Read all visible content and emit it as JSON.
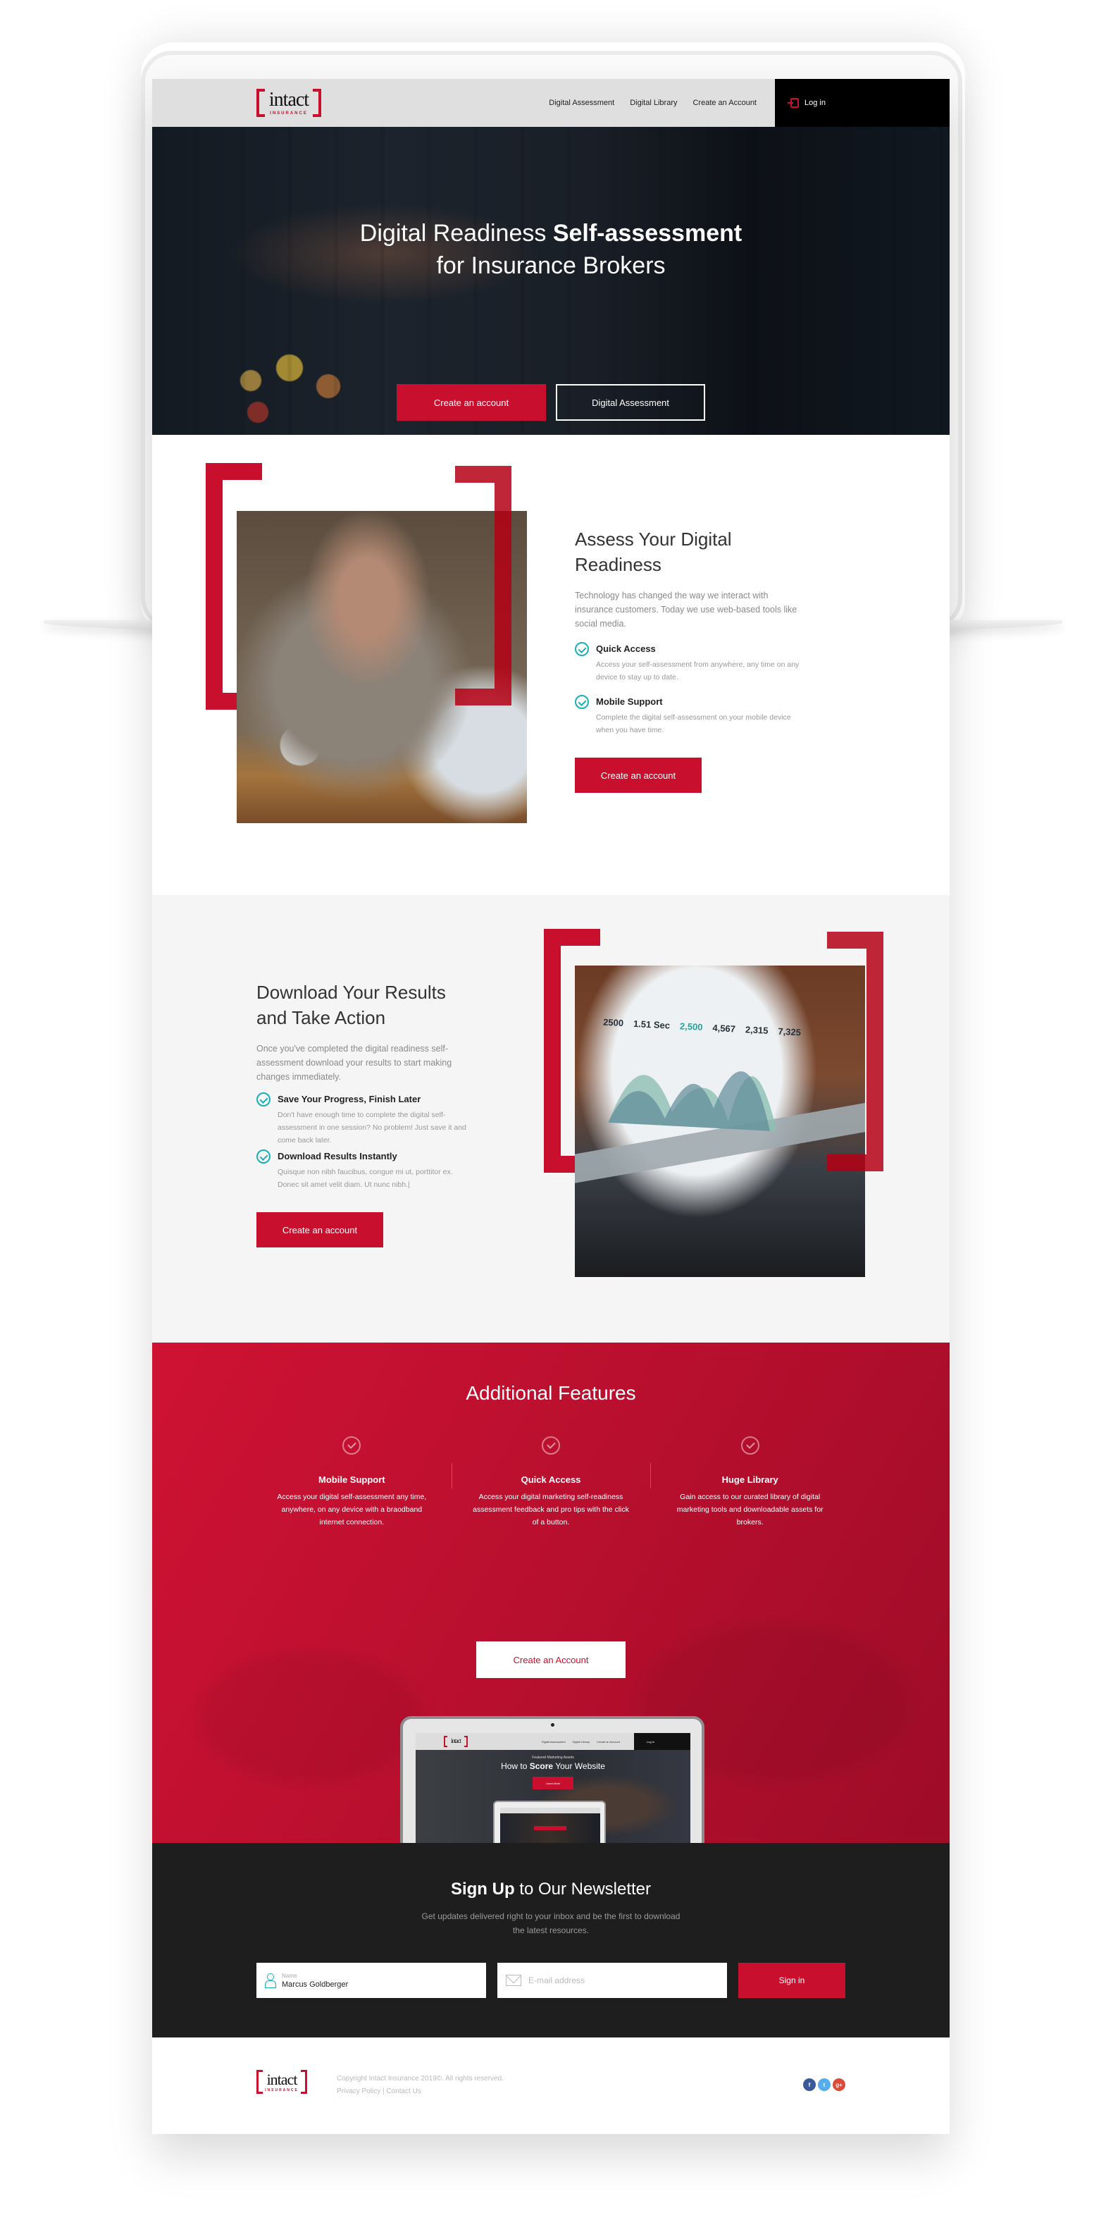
{
  "brand": {
    "logo_word": "intact",
    "logo_sub": "INSURANCE",
    "accent": "#c8102e",
    "check_color": "#1ab0b8"
  },
  "nav": {
    "links": [
      "Digital Assessment",
      "Digital Library",
      "Create an Account"
    ],
    "login_label": "Log in"
  },
  "hero": {
    "title_regular": "Digital Readiness ",
    "title_bold": "Self-assessment",
    "title_line2": "for Insurance Brokers",
    "primary_button": "Create an account",
    "secondary_button": "Digital Assessment"
  },
  "assess": {
    "title": "Assess Your Digital Readiness",
    "lead": "Technology has changed the way we interact with insurance customers. Today we use web-based tools like social media.",
    "features": [
      {
        "title": "Quick Access",
        "text": "Access your self-assessment from anywhere, any time on any device to stay up to date."
      },
      {
        "title": "Mobile Support",
        "text": "Complete the digital self-assessment on your mobile device when you have time."
      }
    ],
    "button": "Create an account"
  },
  "download": {
    "title": "Download Your Results and Take Action",
    "lead": "Once you've completed the digital readiness self-assessment download your results to start making changes immediately.",
    "features": [
      {
        "title": "Save Your Progress, Finish Later",
        "text": "Don't have enough time to complete the digital self-assessment in one session? No problem! Just save it and come back later."
      },
      {
        "title": "Download Results Instantly",
        "text": "Quisque non nibh faucibus, congue mi ut, porttitor ex. Donec sit amet velit diam. Ut nunc nibh.|"
      }
    ],
    "button": "Create an account",
    "dashboard_values": [
      "2500",
      "1.51 Sec",
      "2,500",
      "4,567",
      "2,315",
      "7,325"
    ]
  },
  "features": {
    "title": "Additional Features",
    "items": [
      {
        "title": "Mobile Support",
        "text": "Access your digital self-assessment any time, anywhere, on any device with a braodband internet connection."
      },
      {
        "title": "Quick Access",
        "text": "Access your digital marketing self-readiness assessment feedback and pro tips with the click of a button."
      },
      {
        "title": "Huge Library",
        "text": "Gain access to our curated library of digital marketing tools and downloadable assets for brokers."
      }
    ],
    "button": "Create an Account",
    "preview": {
      "nav_links": [
        "Digital Assessment",
        "Digital Library",
        "Create an Account"
      ],
      "login_label": "Log in",
      "kicker": "Featured Marketing Assets",
      "title_regular_1": "How to ",
      "title_bold": "Score",
      "title_regular_2": " Your Website",
      "button": "Learn More"
    }
  },
  "newsletter": {
    "title_bold": "Sign Up",
    "title_regular": " to Our Newsletter",
    "subtitle": "Get updates delivered right to your inbox and be the first to download the latest resources.",
    "name_label": "Name",
    "name_value": "Marcus Goldberger",
    "email_placeholder": "E-mail address",
    "button": "Sign in"
  },
  "footer": {
    "copyright": "Copyright Intact Insurance 2019©. All rights reserved.",
    "privacy": "Privacy Policy",
    "separator": " | ",
    "contact": "Contact Us",
    "socials": [
      {
        "name": "facebook",
        "glyph": "f",
        "color": "#3b5998"
      },
      {
        "name": "twitter",
        "glyph": "t",
        "color": "#55acee"
      },
      {
        "name": "google-plus",
        "glyph": "g+",
        "color": "#dd4b39"
      }
    ]
  }
}
